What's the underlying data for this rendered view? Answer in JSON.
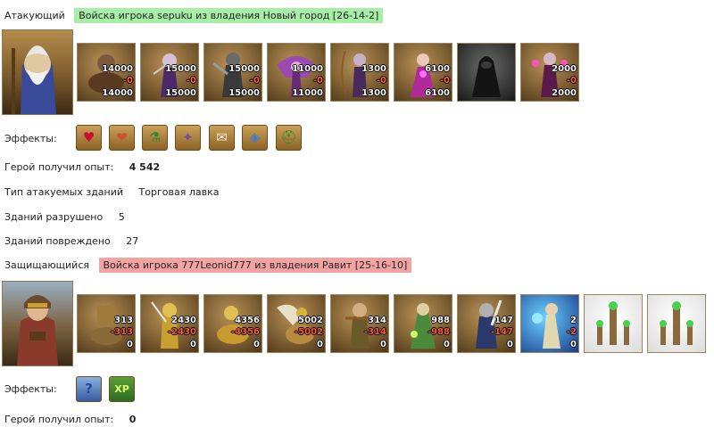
{
  "attacker": {
    "label": "Атакующий",
    "army_title": "Войска игрока sepuku из владения Новый город [26-14-2]",
    "units": [
      {
        "icon": "lizard-rider-icon",
        "count": "14000",
        "lost": "-0",
        "left": "14000",
        "color": "#6b4a2a"
      },
      {
        "icon": "dark-elf-assassin-icon",
        "count": "15000",
        "lost": "-0",
        "left": "15000",
        "color": "#5a3a7a"
      },
      {
        "icon": "dark-knight-icon",
        "count": "15000",
        "lost": "-0",
        "left": "15000",
        "color": "#3a4a3a"
      },
      {
        "icon": "fury-icon",
        "count": "11000",
        "lost": "-0",
        "left": "11000",
        "color": "#8a3aa0"
      },
      {
        "icon": "dark-archer-icon",
        "count": "1300",
        "lost": "-0",
        "left": "1300",
        "color": "#4a2a5a"
      },
      {
        "icon": "sorceress-icon",
        "count": "6100",
        "lost": "-0",
        "left": "6100",
        "color": "#b02a9a"
      },
      {
        "icon": "shadow-assassin-icon",
        "count": "",
        "lost": "",
        "left": "",
        "color": "#2a2a2a"
      },
      {
        "icon": "shadow-witch-icon",
        "count": "2000",
        "lost": "-0",
        "left": "2000",
        "color": "#7a2a6a"
      }
    ],
    "effects_label": "Эффекты:",
    "effects": [
      {
        "icon": "heart-icon",
        "glyph": "♥",
        "color": "#c8102e"
      },
      {
        "icon": "heart-hand-icon",
        "glyph": "❤",
        "color": "#d0502e"
      },
      {
        "icon": "green-potion-icon",
        "glyph": "⚗",
        "color": "#2e8b2e"
      },
      {
        "icon": "magic-rune-icon",
        "glyph": "✦",
        "color": "#7a4aa0"
      },
      {
        "icon": "scroll-icon",
        "glyph": "✉",
        "color": "#e8e0c8"
      },
      {
        "icon": "crystal-orb-icon",
        "glyph": "◈",
        "color": "#3a7ad0"
      },
      {
        "icon": "knight-helmet-icon",
        "glyph": "⛑",
        "color": "#2e8b2e"
      }
    ],
    "exp_label": "Герой получил опыт:",
    "exp_value": "4 542"
  },
  "buildings": {
    "type_label": "Тип атакуемых зданий",
    "type_value": "Торговая лавка",
    "destroyed_label": "Зданий разрушено",
    "destroyed_value": "5",
    "damaged_label": "Зданий повреждено",
    "damaged_value": "27"
  },
  "defender": {
    "label": "Защищающийся",
    "army_title": "Войска игрока 777Leonid777 из владения Равит [25-16-10]",
    "units": [
      {
        "icon": "dwarf-camel-icon",
        "count": "313",
        "lost": "-313",
        "left": "0",
        "color": "#8a6a3a"
      },
      {
        "icon": "golden-knight-icon",
        "count": "2430",
        "lost": "-2430",
        "left": "0",
        "color": "#c8a030"
      },
      {
        "icon": "cavalier-icon",
        "count": "4356",
        "lost": "-4356",
        "left": "0",
        "color": "#c89a30"
      },
      {
        "icon": "griffin-rider-icon",
        "count": "5002",
        "lost": "-5002",
        "left": "0",
        "color": "#b88a40"
      },
      {
        "icon": "crossbowman-icon",
        "count": "314",
        "lost": "-314",
        "left": "0",
        "color": "#6a5a2a"
      },
      {
        "icon": "druid-icon",
        "count": "988",
        "lost": "-988",
        "left": "0",
        "color": "#4a8a3a"
      },
      {
        "icon": "swordsman-icon",
        "count": "147",
        "lost": "-147",
        "left": "0",
        "color": "#2a3a6a"
      },
      {
        "icon": "archmage-icon",
        "count": "2",
        "lost": "-2",
        "left": "0",
        "color": "#3a7ad0"
      },
      {
        "icon": "green-tower-icon",
        "count": "",
        "lost": "",
        "left": "",
        "color": "#7a9a3a"
      },
      {
        "icon": "green-tower-icon",
        "count": "",
        "lost": "",
        "left": "",
        "color": "#7a9a3a"
      }
    ],
    "effects_label": "Эффекты:",
    "effects": [
      {
        "icon": "question-mark-icon",
        "glyph": "?",
        "color": "#1e4aa0"
      },
      {
        "icon": "xp-icon",
        "glyph": "XP",
        "color": "#2e8b2e"
      }
    ],
    "exp_label": "Герой получил опыт:",
    "exp_value": "0"
  }
}
